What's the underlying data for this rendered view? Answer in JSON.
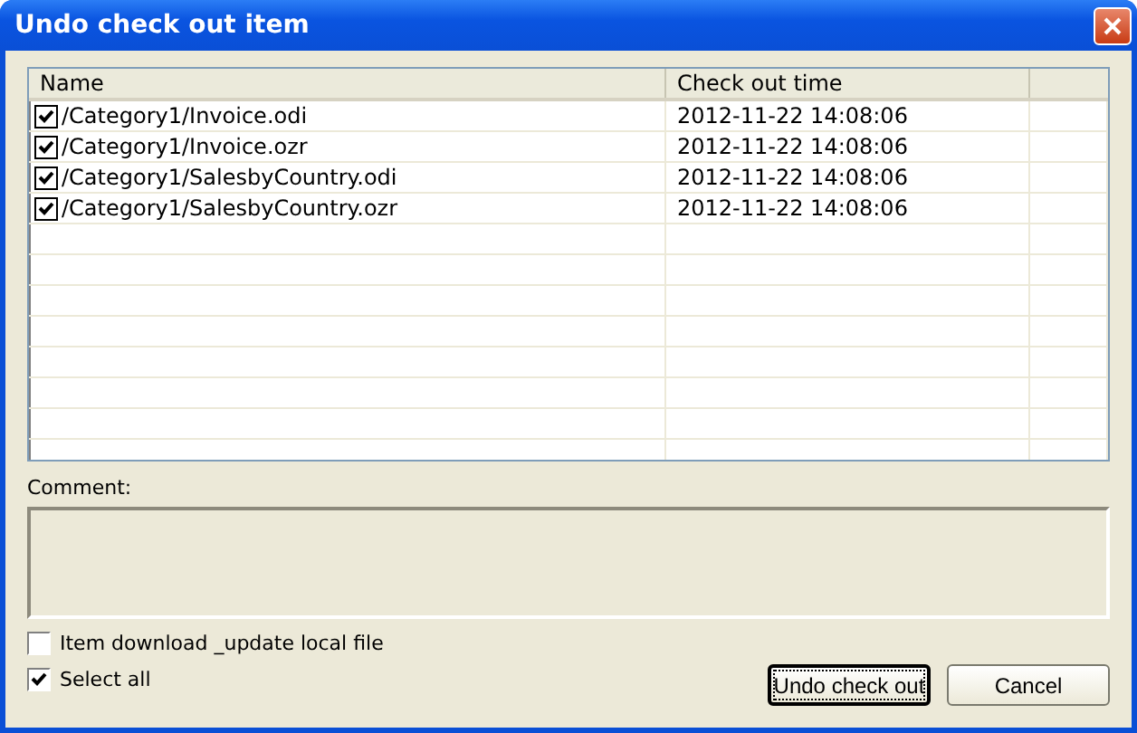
{
  "window": {
    "title": "Undo check out item"
  },
  "table": {
    "columns": [
      "Name",
      "Check out time"
    ],
    "rows": [
      {
        "name": "/Category1/Invoice.odi",
        "time": "2012-11-22 14:08:06",
        "checked": true
      },
      {
        "name": "/Category1/Invoice.ozr",
        "time": "2012-11-22 14:08:06",
        "checked": true
      },
      {
        "name": "/Category1/SalesbyCountry.odi",
        "time": "2012-11-22 14:08:06",
        "checked": true
      },
      {
        "name": "/Category1/SalesbyCountry.ozr",
        "time": "2012-11-22 14:08:06",
        "checked": true
      }
    ]
  },
  "comment": {
    "label": "Comment:"
  },
  "options": [
    {
      "label": "Item download _update local file",
      "checked": false
    },
    {
      "label": "Select all",
      "checked": true
    }
  ],
  "buttons": [
    {
      "label": "Undo check out",
      "selected": true
    },
    {
      "label": "Cancel",
      "selected": false
    }
  ]
}
